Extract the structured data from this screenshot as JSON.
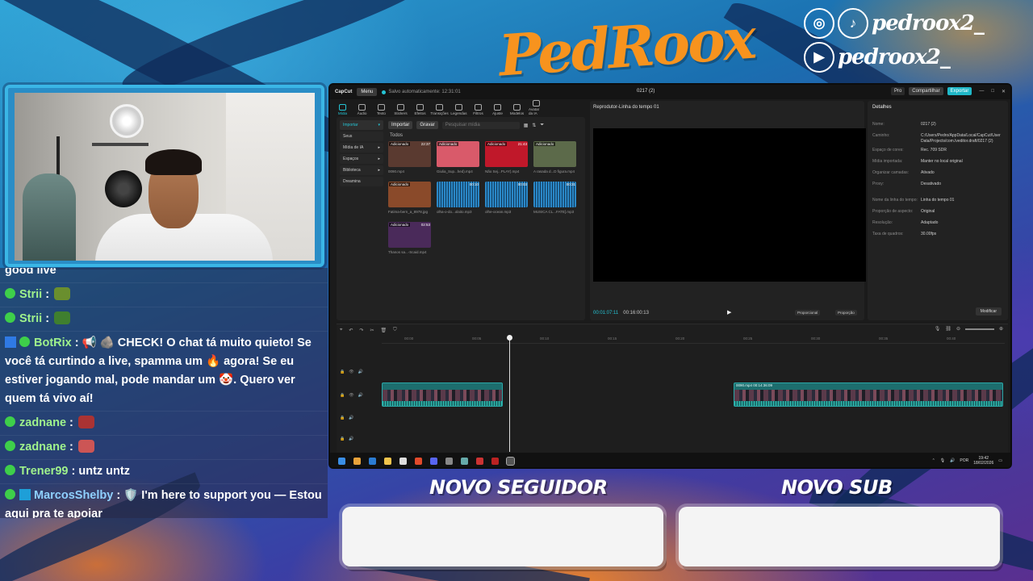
{
  "overlay": {
    "brand": "PedRoox",
    "socials": [
      {
        "icon": "instagram-icon",
        "glyph": "◎",
        "handle": "pedroox2_"
      },
      {
        "icon": "tiktok-icon",
        "glyph": "♪",
        "handle": "pedroox2_"
      },
      {
        "icon": "youtube-icon",
        "glyph": "▶",
        "handle": "pedroox2_"
      }
    ],
    "alerts": {
      "follower_title": "NOVO SEGUIDOR",
      "sub_title": "NOVO SUB"
    },
    "colors": {
      "brand_orange": "#f7931e",
      "cam_border": "#3ab6e6",
      "chat_username": "#9ff28c"
    }
  },
  "chat": [
    {
      "user": "",
      "text": "good live",
      "partial": true
    },
    {
      "user": "Strii",
      "text": ":",
      "emote": "#6a8f2e"
    },
    {
      "user": "Strii",
      "text": ":",
      "emote": "#3f7f2f"
    },
    {
      "user": "BotRix",
      "text": ": 📢 🪨 CHECK! O chat tá muito quieto! Se você tá curtindo a live, spamma um 🔥 agora! Se eu estiver jogando mal, pode mandar um 🤡. Quero ver quem tá vivo aí!",
      "badge": true
    },
    {
      "user": "zadnane",
      "text": ":",
      "emote": "#a33"
    },
    {
      "user": "zadnane",
      "text": ":",
      "emote": "#c55"
    },
    {
      "user": "Trener99",
      "text": ": untz untz"
    },
    {
      "user": "MarcosShelby",
      "text": ": 🛡️ I'm here to support you — Estou aqui pra te apoiar",
      "badge": true
    }
  ],
  "editor": {
    "app_name": "CapCut",
    "menu": "Menu",
    "autosave": "Salvo automaticamente: 12:31:01",
    "project_title": "0217 (2)",
    "pro": "Pro",
    "share": "Compartilhar",
    "export": "Exportar",
    "toolbar": [
      "Mídia",
      "Áudio",
      "Texto",
      "Stickers",
      "Efeitos",
      "Transições",
      "Legendas",
      "Filtros",
      "Ajuste",
      "Modelos",
      "Avatar da IA"
    ],
    "media_side": [
      "Importar",
      "Seus",
      "Mídia de IA",
      "Espaços",
      "Biblioteca",
      "Dreamina"
    ],
    "import_btn": "Importar",
    "record_btn": "Gravar",
    "search_placeholder": "Pesquisar mídia",
    "all_label": "Todos",
    "clips": [
      {
        "name": "0090.mp4",
        "tag": "Adicionado",
        "dur": "22:37",
        "color": "#5a3a30"
      },
      {
        "name": "Giulia_Sup...hed).mp4",
        "tag": "Adicionado",
        "dur": "",
        "color": "#d95a6a"
      },
      {
        "name": "Não Sej...PLAY).mp4",
        "tag": "Adicionado",
        "dur": "21:43",
        "color": "#c0182a"
      },
      {
        "name": "A rasada d...D figura.mp4",
        "tag": "Adicionado",
        "dur": "",
        "color": "#5c6a4a"
      },
      {
        "name": "Fatima-bern_a_8978.jpg",
        "tag": "Adicionado",
        "dur": "",
        "color": "#8a4a2a"
      },
      {
        "name": "olha-o-do...olaito.mp3",
        "tag": "",
        "dur": "00:10",
        "color": "#1a6aa0"
      },
      {
        "name": "olhe-ocean.mp3",
        "tag": "",
        "dur": "00:03",
        "color": "#1a6aa0"
      },
      {
        "name": "MUSICA CL...FATE].mp3",
        "tag": "",
        "dur": "00:31",
        "color": "#1a6aa0"
      },
      {
        "name": "Thanos sa...-Scaid.mp4",
        "tag": "Adicionado",
        "dur": "02:53",
        "color": "#4a2a5a"
      }
    ],
    "player": {
      "title": "Reprodutor-Linha do tempo 01",
      "current": "00:01:07:11",
      "total": "00:16:00:13",
      "fit_btn": "Proporcional",
      "ratio_btn": "Proporção"
    },
    "details": {
      "title": "Detalhes",
      "rows": [
        {
          "k": "Nome:",
          "v": "0217 (2)"
        },
        {
          "k": "Caminho:",
          "v": "C:/Users/Pedro/AppData/Local/CapCut/User Data/Projects/com.lveditor.draft/0217 (2)"
        },
        {
          "k": "Espaço de cores:",
          "v": "Rec. 709 SDR"
        },
        {
          "k": "Mídia importada:",
          "v": "Manter no local original"
        },
        {
          "k": "Organizar camadas:",
          "v": "Ativado"
        },
        {
          "k": "Proxy:",
          "v": "Desativado"
        },
        {
          "k": "Nome da linha do tempo:",
          "v": "Linha do tempo 01"
        },
        {
          "k": "Proporção de aspecto:",
          "v": "Original"
        },
        {
          "k": "Resolução:",
          "v": "Adaptado"
        },
        {
          "k": "Taxa de quadros:",
          "v": "30.00fps"
        }
      ],
      "modify_btn": "Modificar"
    },
    "timeline": {
      "ruler": [
        "00:00",
        "00:05",
        "00:10",
        "00:15",
        "00:20",
        "00:25",
        "00:30",
        "00:35",
        "00:40"
      ],
      "clip_label": "0090.mp4  00:14:36:09"
    },
    "taskbar": {
      "lang": "POR",
      "time": "19:42",
      "date": "18/02/2026"
    }
  }
}
